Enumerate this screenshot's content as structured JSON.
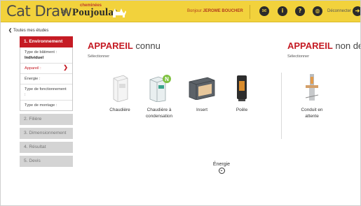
{
  "header": {
    "app_name": "Cat Draw",
    "brand_by": "by",
    "brand_top": "cheminées",
    "brand_name": "Poujoulat",
    "greeting_prefix": "Bonjour",
    "user_name": "JEROME BOUCHER",
    "logout_label": "Déconnecter",
    "accent_color": "#f2d23c"
  },
  "nav": {
    "back_label": "Toutes mes études"
  },
  "steps": [
    {
      "label": "1. Environnement",
      "state": "active"
    },
    {
      "label": "2. Filière",
      "state": "disabled"
    },
    {
      "label": "3. Dimensionnement",
      "state": "disabled"
    },
    {
      "label": "4. Résultat",
      "state": "disabled"
    },
    {
      "label": "5. Devis",
      "state": "disabled"
    }
  ],
  "env_subitems": [
    {
      "label": "Type de bâtiment :",
      "value": "Individuel"
    },
    {
      "label": "Appareil :",
      "value": ""
    },
    {
      "label": "Énergie :",
      "value": ""
    },
    {
      "label": "Type de fonctionnement :",
      "value": ""
    },
    {
      "label": "Type de montage :",
      "value": ""
    }
  ],
  "known": {
    "title_em": "APPAREIL",
    "title_rest": "connu",
    "subtitle": "Sélectionner",
    "items": [
      {
        "label": "Chaudière",
        "icon": "boiler-icon"
      },
      {
        "label": "Chaudière à condensation",
        "icon": "condensing-boiler-icon"
      },
      {
        "label": "Insert",
        "icon": "fireplace-insert-icon"
      },
      {
        "label": "Poêle",
        "icon": "stove-icon"
      }
    ]
  },
  "undefined_section": {
    "title_em": "APPAREIL",
    "title_rest": "non défini",
    "subtitle": "Sélectionner",
    "items": [
      {
        "label": "Conduit en attente",
        "icon": "chimney-flue-icon"
      }
    ]
  },
  "footer": {
    "energie_label": "Énergie"
  },
  "colors": {
    "primary_red": "#c51b24",
    "disabled_gray": "#d4d4d4"
  }
}
